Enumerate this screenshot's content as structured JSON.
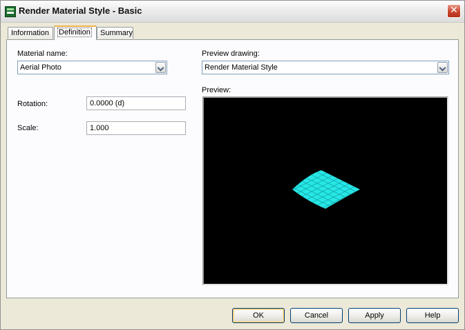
{
  "window": {
    "title": "Render Material Style - Basic",
    "close_glyph": "✕"
  },
  "tabs": [
    {
      "label": "Information",
      "active": false
    },
    {
      "label": "Definition",
      "active": true
    },
    {
      "label": "Summary",
      "active": false
    }
  ],
  "definition": {
    "material_name_label": "Material name:",
    "material_name_value": "Aerial Photo",
    "rotation_label": "Rotation:",
    "rotation_value": "0.0000 (d)",
    "scale_label": "Scale:",
    "scale_value": "1.000",
    "preview_drawing_label": "Preview drawing:",
    "preview_drawing_value": "Render Material Style",
    "preview_label": "Preview:"
  },
  "preview_render": {
    "background_color": "#000000",
    "mesh_color": "#27e6e6"
  },
  "buttons": {
    "ok": "OK",
    "cancel": "Cancel",
    "apply": "Apply",
    "help": "Help"
  },
  "icons": {
    "app": "render-material-style-icon",
    "close": "close-icon",
    "dropdown": "chevron-down-icon"
  }
}
